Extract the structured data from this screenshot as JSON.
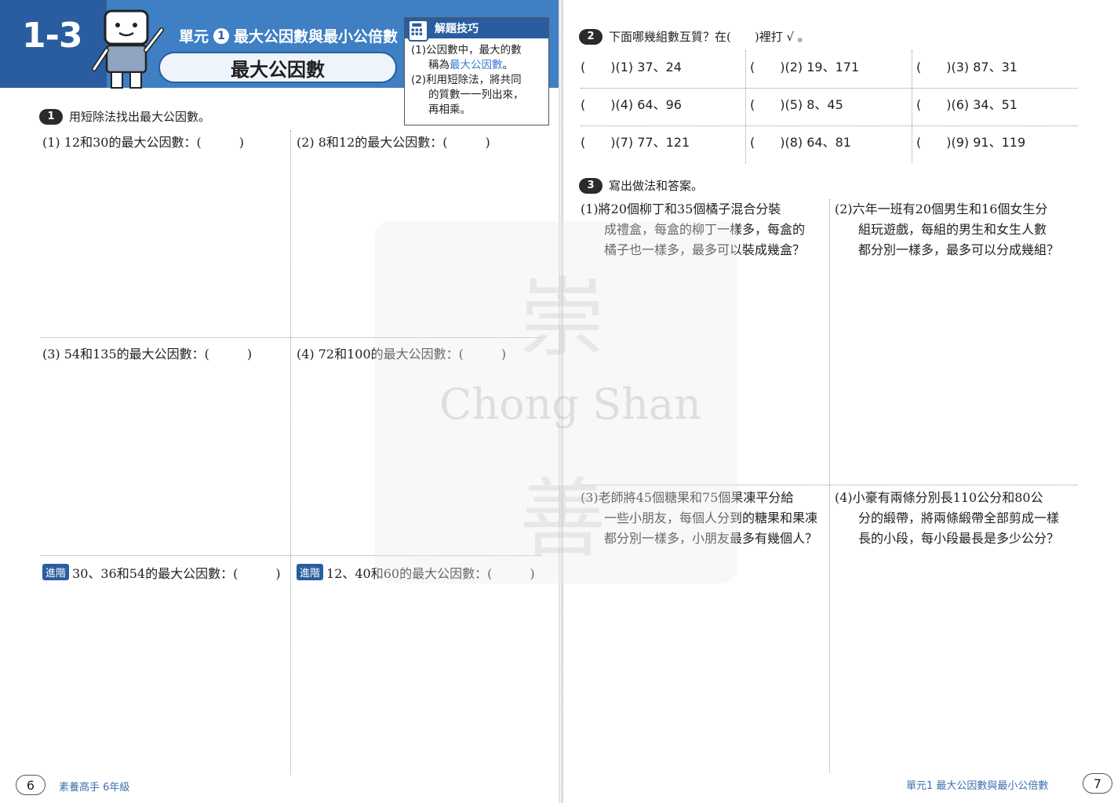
{
  "left_page": {
    "lesson_number": "1-3",
    "unit_label": "單元",
    "unit_number": "1",
    "unit_title": "最大公因數與最小公倍數",
    "lesson_title": "最大公因數",
    "tips": {
      "heading": "解題技巧",
      "line1": "(1)公因數中，最大的數",
      "line2_pre": "稱為",
      "line2_highlight": "最大公因數",
      "line2_post": "。",
      "line3": "(2)利用短除法，將共同",
      "line4": "的質數一一列出來，",
      "line5": "再相乘。"
    },
    "q1": {
      "badge": "1",
      "instruction": "用短除法找出最大公因數。",
      "items": [
        "(1) 12和30的最大公因數：(　　　)",
        "(2) 8和12的最大公因數：(　　　)",
        "(3) 54和135的最大公因數：(　　　)",
        "(4) 72和100的最大公因數：(　　　)"
      ],
      "advanced_tag": "進階",
      "advanced_items": [
        "30、36和54的最大公因數：(　　　)",
        "12、40和60的最大公因數：(　　　)"
      ]
    },
    "page_number": "6",
    "footer": "素養高手  6年級"
  },
  "right_page": {
    "q2": {
      "badge": "2",
      "instruction": "下面哪幾組數互質？在(　　)裡打 √ 。",
      "items": [
        "(　　)(1) 37、24",
        "(　　)(2) 19、171",
        "(　　)(3) 87、31",
        "(　　)(4) 64、96",
        "(　　)(5) 8、45",
        "(　　)(6) 34、51",
        "(　　)(7) 77、121",
        "(　　)(8) 64、81",
        "(　　)(9) 91、119"
      ]
    },
    "q3": {
      "badge": "3",
      "instruction": "寫出做法和答案。",
      "problems": [
        {
          "num": "(1)",
          "line1": "將20個柳丁和35個橘子混合分裝",
          "line2": "成禮盒，每盒的柳丁一樣多，每盒的",
          "line3": "橘子也一樣多，最多可以裝成幾盒？"
        },
        {
          "num": "(2)",
          "line1": "六年一班有20個男生和16個女生分",
          "line2": "組玩遊戲，每組的男生和女生人數",
          "line3": "都分別一樣多，最多可以分成幾組？"
        },
        {
          "num": "(3)",
          "line1": "老師將45個糖果和75個果凍平分給",
          "line2": "一些小朋友，每個人分到的糖果和果凍",
          "line3": "都分別一樣多，小朋友最多有幾個人？"
        },
        {
          "num": "(4)",
          "line1": "小豪有兩條分別長110公分和80公",
          "line2": "分的緞帶，將兩條緞帶全部剪成一樣",
          "line3": "長的小段，每小段最長是多少公分？"
        }
      ]
    },
    "page_number": "7",
    "footer": "單元1  最大公因數與最小公倍數"
  },
  "watermark": {
    "text": "Chong Shan",
    "char_top": "崇",
    "char_bottom": "善"
  },
  "colors": {
    "header_blue": "#3f7fc4",
    "header_dark_blue": "#2a5d9f",
    "highlight_blue": "#3a7bd5"
  }
}
